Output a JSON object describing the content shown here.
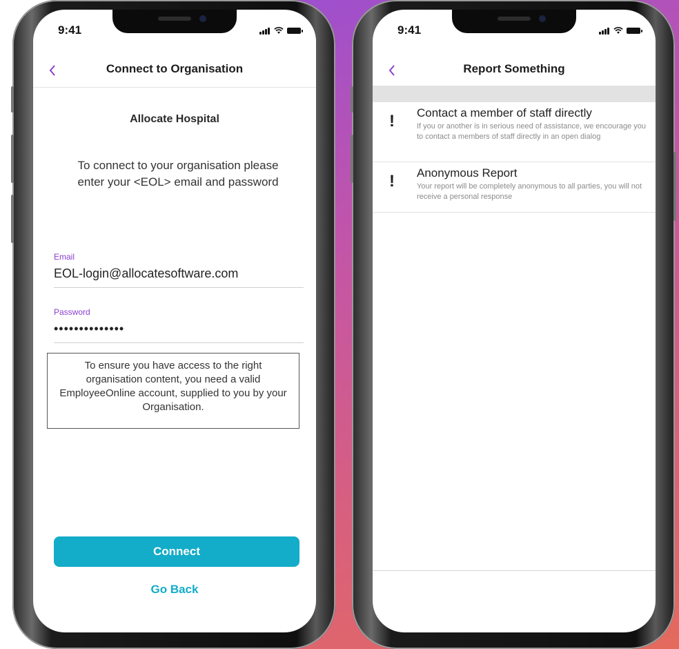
{
  "background": {
    "gradient_colors": [
      "#9b4fd0",
      "#d9607c",
      "#e46a5d"
    ]
  },
  "accent_colors": {
    "purple": "#8a3fd1",
    "teal": "#13acc9"
  },
  "left_phone": {
    "status_time": "9:41",
    "nav": {
      "back_icon": "chevron-left-icon",
      "title": "Connect to Organisation"
    },
    "organisation_name": "Allocate Hospital",
    "instructions": "To connect to your organisation please enter your <EOL> email and password",
    "email": {
      "label": "Email",
      "value": "EOL-login@allocatesoftware.com"
    },
    "password": {
      "label": "Password",
      "value": "••••••••••••••"
    },
    "notice": "To ensure you have access to the right organisation content, you need a valid EmployeeOnline account, supplied to you by your Organisation.",
    "connect_label": "Connect",
    "go_back_label": "Go Back"
  },
  "right_phone": {
    "status_time": "9:41",
    "nav": {
      "back_icon": "chevron-left-icon",
      "title": "Report Something"
    },
    "items": [
      {
        "icon": "exclamation-icon",
        "title": "Contact a member of staff directly",
        "description": "If you or another is in serious need of assistance, we encourage you to contact a members of staff directly in an open dialog"
      },
      {
        "icon": "exclamation-icon",
        "title": "Anonymous Report",
        "description": "Your report will be completely anonymous to all parties, you will not receive a personal response"
      }
    ]
  }
}
